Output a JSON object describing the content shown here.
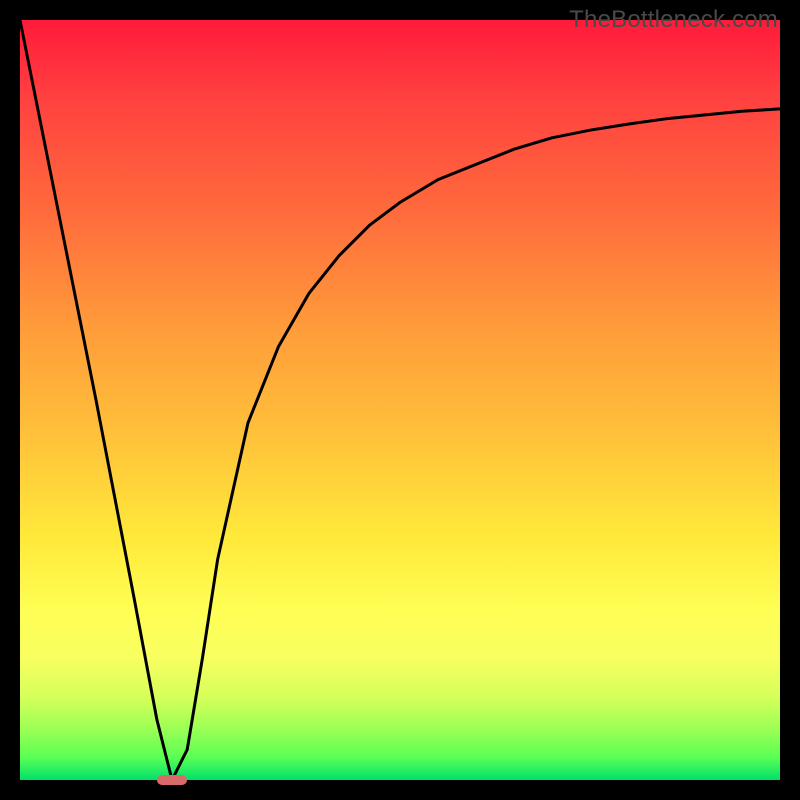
{
  "watermark_text": "TheBottleneck.com",
  "chart_data": {
    "type": "line",
    "title": "",
    "xlabel": "",
    "ylabel": "",
    "xlim": [
      0,
      100
    ],
    "ylim": [
      0,
      100
    ],
    "background_gradient": {
      "top": "#ff1a3a",
      "bottom": "#00e06a",
      "meaning": "red=high bottleneck, green=low bottleneck"
    },
    "series": [
      {
        "name": "bottleneck-curve",
        "x": [
          0,
          5,
          10,
          15,
          18,
          20,
          22,
          24,
          26,
          30,
          34,
          38,
          42,
          46,
          50,
          55,
          60,
          65,
          70,
          75,
          80,
          85,
          90,
          95,
          100
        ],
        "values": [
          100,
          75,
          50,
          24,
          8,
          0,
          4,
          16,
          29,
          47,
          57,
          64,
          69,
          73,
          76,
          79,
          81,
          83,
          84.5,
          85.5,
          86.3,
          87,
          87.5,
          88,
          88.3
        ]
      }
    ],
    "marker": {
      "name": "optimal-point",
      "x": 20,
      "y": 0,
      "width_pct": 4,
      "height_pct": 1.2,
      "color": "#d86a6a"
    },
    "grid": false,
    "legend": false
  }
}
